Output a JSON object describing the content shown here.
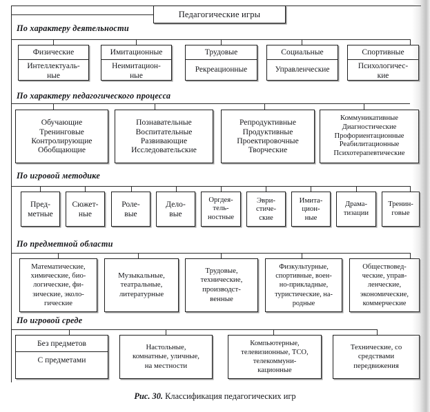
{
  "figure": {
    "root_label": "Педагогические игры",
    "caption_prefix": "Рис. 30.",
    "caption_text": " Классификация педагогических игр"
  },
  "sections": [
    {
      "id": "po-harakteru-deyatelnosti",
      "label": "По характеру деятельности",
      "boxes": [
        {
          "top": "Физические",
          "bottom": "Интеллектуаль-\nные"
        },
        {
          "top": "Имитационные",
          "bottom": "Неимитацион-\nные"
        },
        {
          "top": "Трудовые",
          "bottom": "Рекреационные"
        },
        {
          "top": "Социальные",
          "bottom": "Управленческие"
        },
        {
          "top": "Спортивные",
          "bottom": "Психологичес-\nкие"
        }
      ]
    },
    {
      "id": "po-harakteru-pedagogicheskogo-processa",
      "label": "По характеру педагогического процесса",
      "boxes": [
        {
          "lines": [
            "Обучающие",
            "Тренинговые",
            "Контролирующие",
            "Обобщающие"
          ]
        },
        {
          "lines": [
            "Познавательные",
            "Воспитательные",
            "Развивающие",
            "Исследовательские"
          ]
        },
        {
          "lines": [
            "Репродуктивные",
            "Продуктивные",
            "Проектировочные",
            "Творческие"
          ]
        },
        {
          "lines": [
            "Коммуникативные",
            "Диагностические",
            "Профориентационные",
            "Реабилитационные",
            "Психотерапевтические"
          ]
        }
      ]
    },
    {
      "id": "po-igrovoy-metodike",
      "label": "По игровой методике",
      "boxes": [
        {
          "lines": [
            "Пред-",
            "метные"
          ]
        },
        {
          "lines": [
            "Сюжет-",
            "ные"
          ]
        },
        {
          "lines": [
            "Роле-",
            "вые"
          ]
        },
        {
          "lines": [
            "Дело-",
            "вые"
          ]
        },
        {
          "lines": [
            "Оргдея-",
            "тель-",
            "ностные"
          ]
        },
        {
          "lines": [
            "Эври-",
            "стиче-",
            "ские"
          ]
        },
        {
          "lines": [
            "Имита-",
            "цион-",
            "ные"
          ]
        },
        {
          "lines": [
            "Драма-",
            "тизации"
          ]
        },
        {
          "lines": [
            "Тренин-",
            "говые"
          ]
        }
      ]
    },
    {
      "id": "po-predmetnoy-oblasti",
      "label": "По предметной области",
      "boxes": [
        {
          "lines": [
            "Математические,",
            "химические, био-",
            "логические, фи-",
            "зические, эколо-",
            "гические"
          ]
        },
        {
          "lines": [
            "Музыкальные,",
            "театральные,",
            "литературные"
          ]
        },
        {
          "lines": [
            "Трудовые,",
            "технические,",
            "производст-",
            "венные"
          ]
        },
        {
          "lines": [
            "Физкультурные,",
            "спортивные, воен-",
            "но-прикладные,",
            "туристические, на-",
            "родные"
          ]
        },
        {
          "lines": [
            "Обществовед-",
            "ческие, управ-",
            "ленческие,",
            "экономические,",
            "коммерческие"
          ]
        }
      ]
    },
    {
      "id": "po-igrovoy-srede",
      "label": "По игровой среде",
      "boxes": [
        {
          "top": "Без предметов",
          "bottom": "С предметами"
        },
        {
          "lines": [
            "Настольные,",
            "комнатные, уличные,",
            "на местности"
          ]
        },
        {
          "lines": [
            "Компьютерные,",
            "телевизионные, ТСО,",
            "телекоммуни-",
            "кационные"
          ]
        },
        {
          "lines": [
            "Технические, со",
            "средствами",
            "передвижения"
          ]
        }
      ]
    }
  ],
  "colors": {
    "ink": "#15161a",
    "line": "#2a2a2a",
    "paper": "#ffffff"
  }
}
